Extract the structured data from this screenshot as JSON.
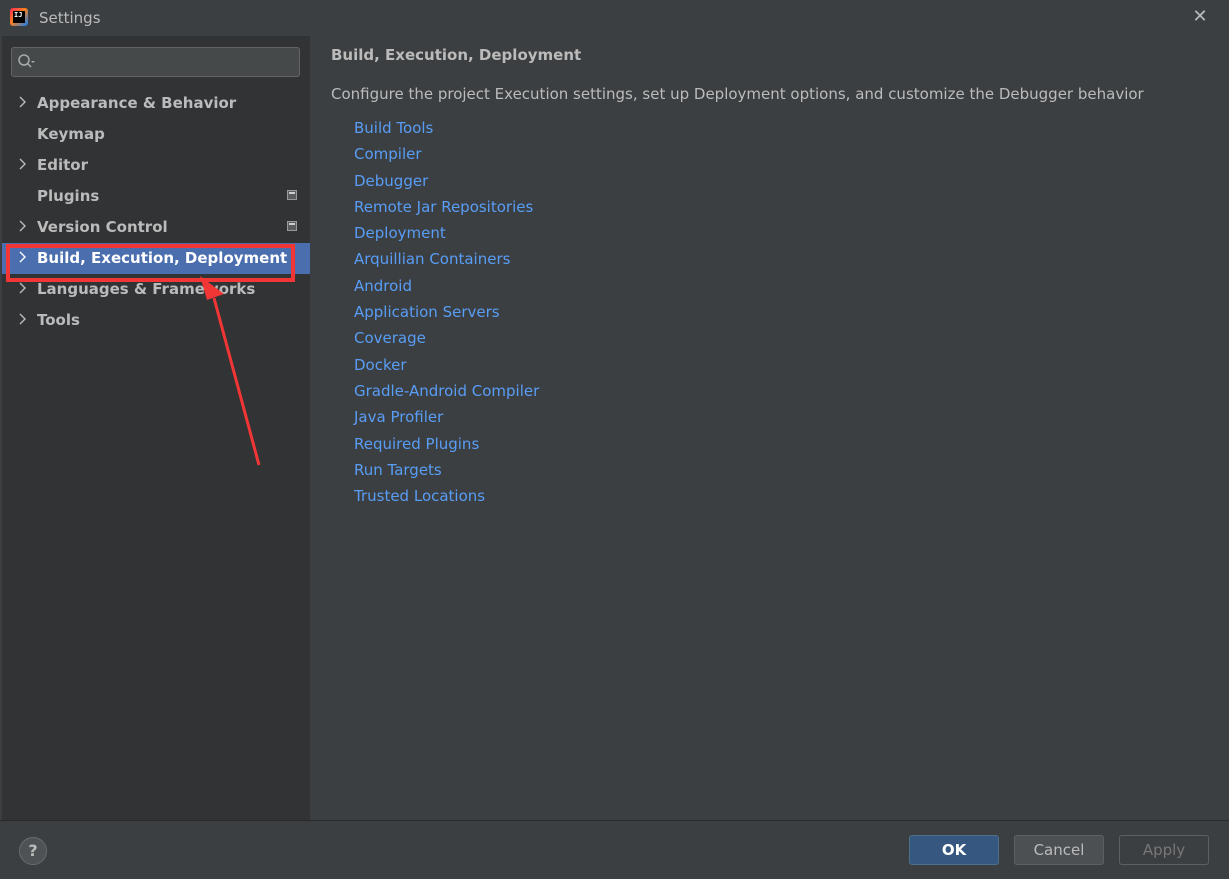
{
  "window": {
    "title": "Settings",
    "app_icon_text": "IJ",
    "close_glyph": "✕"
  },
  "sidebar": {
    "search": {
      "value": "",
      "placeholder": ""
    },
    "items": [
      {
        "label": "Appearance & Behavior",
        "expandable": true,
        "badge": false
      },
      {
        "label": "Keymap",
        "expandable": false,
        "badge": false
      },
      {
        "label": "Editor",
        "expandable": true,
        "badge": false
      },
      {
        "label": "Plugins",
        "expandable": false,
        "badge": true
      },
      {
        "label": "Version Control",
        "expandable": true,
        "badge": true
      },
      {
        "label": "Build, Execution, Deployment",
        "expandable": true,
        "badge": false,
        "selected": true
      },
      {
        "label": "Languages & Frameworks",
        "expandable": true,
        "badge": false
      },
      {
        "label": "Tools",
        "expandable": true,
        "badge": false
      }
    ]
  },
  "main": {
    "title": "Build, Execution, Deployment",
    "description": "Configure the project Execution settings, set up Deployment options, and customize the Debugger behavior",
    "links": [
      "Build Tools",
      "Compiler",
      "Debugger",
      "Remote Jar Repositories",
      "Deployment",
      "Arquillian Containers",
      "Android",
      "Application Servers",
      "Coverage",
      "Docker",
      "Gradle-Android Compiler",
      "Java Profiler",
      "Required Plugins",
      "Run Targets",
      "Trusted Locations"
    ]
  },
  "footer": {
    "help_label": "?",
    "ok_label": "OK",
    "cancel_label": "Cancel",
    "apply_label": "Apply"
  },
  "colors": {
    "background": "#3c3f41",
    "sidebar": "#313335",
    "selection": "#4b6eaf",
    "link": "#589df6",
    "annotation": "#f23535",
    "primary_button": "#365880"
  }
}
